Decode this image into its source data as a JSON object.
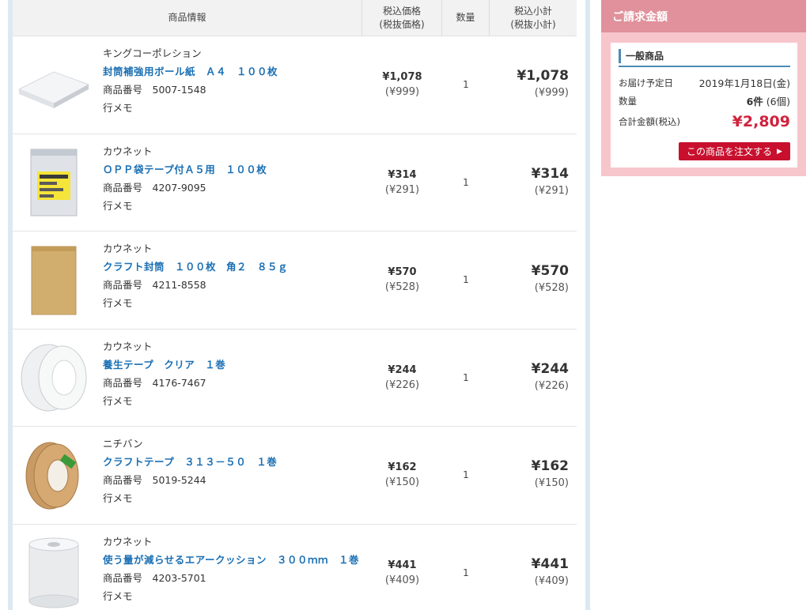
{
  "table": {
    "headers": {
      "info": "商品情報",
      "price_l1": "税込価格",
      "price_l2": "(税抜価格)",
      "qty": "数量",
      "sub_l1": "税込小計",
      "sub_l2": "(税抜小計)"
    },
    "rows": [
      {
        "maker": "キングコーポレション",
        "name": "封筒補強用ボール紙　Ａ４　１００枚",
        "product_no": "商品番号　5007-1548",
        "memo": "行メモ",
        "price_inc": "¥1,078",
        "price_exc": "(¥999)",
        "qty": "1",
        "sub_inc": "¥1,078",
        "sub_exc": "(¥999)",
        "thumb_icon": "paper-board-icon"
      },
      {
        "maker": "カウネット",
        "name": "ＯＰＰ袋テープ付Ａ５用　１００枚",
        "product_no": "商品番号　4207-9095",
        "memo": "行メモ",
        "price_inc": "¥314",
        "price_exc": "(¥291)",
        "qty": "1",
        "sub_inc": "¥314",
        "sub_exc": "(¥291)",
        "thumb_icon": "opp-bag-icon"
      },
      {
        "maker": "カウネット",
        "name": "クラフト封筒　１００枚　角２　８５ｇ",
        "product_no": "商品番号　4211-8558",
        "memo": "行メモ",
        "price_inc": "¥570",
        "price_exc": "(¥528)",
        "qty": "1",
        "sub_inc": "¥570",
        "sub_exc": "(¥528)",
        "thumb_icon": "kraft-envelope-icon"
      },
      {
        "maker": "カウネット",
        "name": "養生テープ　クリア　１巻",
        "product_no": "商品番号　4176-7467",
        "memo": "行メモ",
        "price_inc": "¥244",
        "price_exc": "(¥226)",
        "qty": "1",
        "sub_inc": "¥244",
        "sub_exc": "(¥226)",
        "thumb_icon": "clear-tape-icon"
      },
      {
        "maker": "ニチバン",
        "name": "クラフトテープ　３１３－５０　１巻",
        "product_no": "商品番号　5019-5244",
        "memo": "行メモ",
        "price_inc": "¥162",
        "price_exc": "(¥150)",
        "qty": "1",
        "sub_inc": "¥162",
        "sub_exc": "(¥150)",
        "thumb_icon": "kraft-tape-icon"
      },
      {
        "maker": "カウネット",
        "name": "使う量が減らせるエアークッション　３００ｍｍ　１巻",
        "product_no": "商品番号　4203-5701",
        "memo": "行メモ",
        "price_inc": "¥441",
        "price_exc": "(¥409)",
        "qty": "1",
        "sub_inc": "¥441",
        "sub_exc": "(¥409)",
        "thumb_icon": "air-cushion-roll-icon"
      }
    ]
  },
  "summary": {
    "title": "ご請求金額",
    "category": "一般商品",
    "delivery_label": "お届け予定日",
    "delivery_value": "2019年1月18日(金)",
    "qty_label": "数量",
    "qty_value_bold": "6件",
    "qty_value_rest": " (6個)",
    "total_label": "合計金額(税込)",
    "total_value": "¥2,809",
    "order_button": "この商品を注文する",
    "order_arrow": "▶"
  },
  "colors": {
    "link_blue": "#1a6fb3",
    "summary_bg": "#f7c5cc",
    "summary_header": "#e0919b",
    "total_red": "#d0223c",
    "order_button": "#c8102e"
  }
}
